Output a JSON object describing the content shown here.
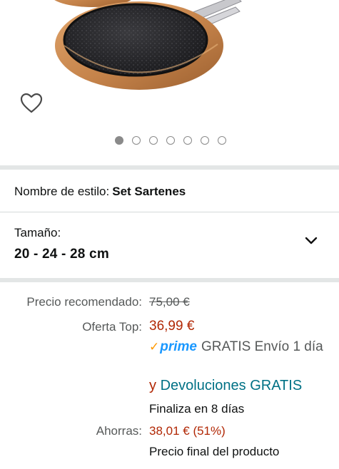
{
  "gallery": {
    "wishlist_icon": "heart-outline-icon",
    "dots_total": 7,
    "active_dot": 1,
    "colors": {
      "pan_copper": "#c98a52",
      "pan_interior": "#2b2b2e",
      "dot": "#8a8a8a"
    }
  },
  "style": {
    "label": "Nombre de estilo:",
    "value": "Set Sartenes"
  },
  "size": {
    "label": "Tamaño:",
    "value": "20 - 24 - 28 cm",
    "icon": "chevron-down-icon"
  },
  "pricing": {
    "recommended_label": "Precio recomendado:",
    "recommended_value": "75,00 €",
    "offer_label": "Oferta Top:",
    "offer_value": "36,99 €",
    "prime_check": "✓",
    "prime_word": "prime",
    "shipping_text": "GRATIS Envío 1 día",
    "returns_prefix": "y",
    "returns_link": "Devoluciones GRATIS",
    "ends_text": "Finaliza en 8 días",
    "savings_label": "Ahorras:",
    "savings_value": "38,01 € (51%)",
    "final_text": "Precio final del producto",
    "colors": {
      "price_red": "#b12704",
      "link_teal": "#007185",
      "prime_blue": "#1a98ff",
      "prime_orange": "#ff9900"
    }
  }
}
